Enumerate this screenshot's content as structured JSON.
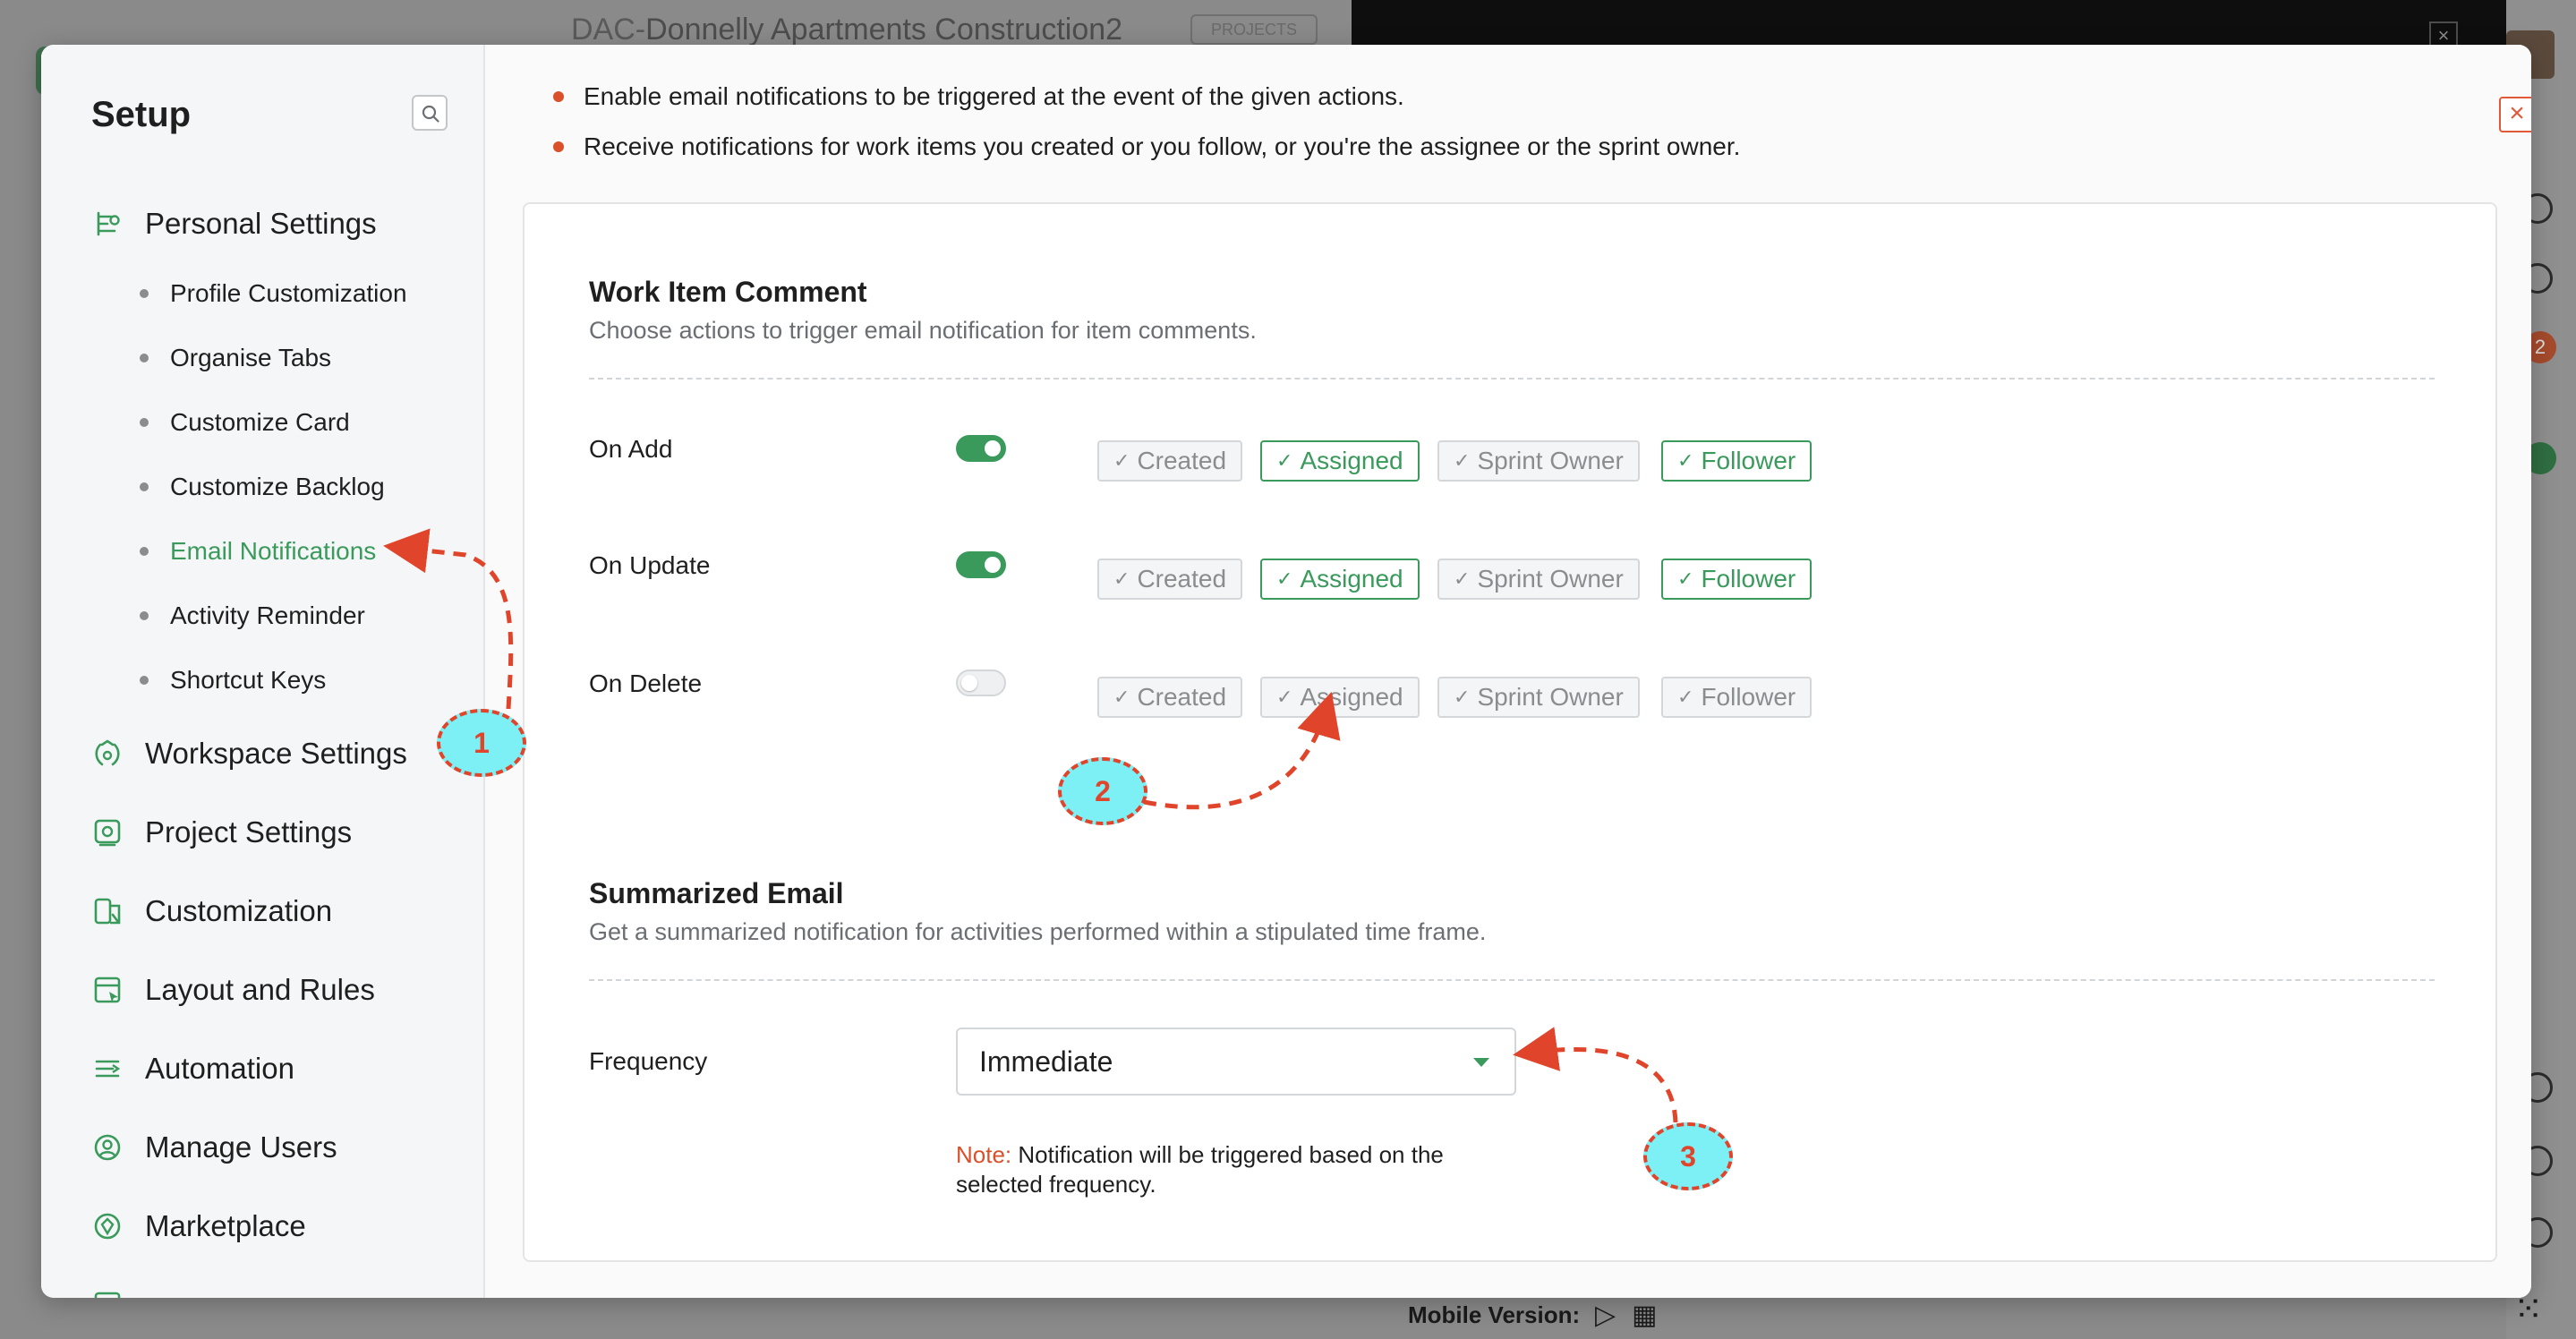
{
  "background": {
    "project_code": "DAC-",
    "project_name": "Donnelly Apartments Construction2",
    "project_badge": "PROJECTS",
    "rail_badge": "2",
    "mobile_label": "Mobile Version:"
  },
  "setup": {
    "title": "Setup",
    "search_icon": "search-icon",
    "groups": [
      {
        "label": "Personal Settings",
        "icon": "personal-settings-icon"
      },
      {
        "label": "Workspace Settings",
        "icon": "workspace-settings-icon"
      },
      {
        "label": "Project Settings",
        "icon": "project-settings-icon"
      },
      {
        "label": "Customization",
        "icon": "customization-icon"
      },
      {
        "label": "Layout and Rules",
        "icon": "layout-rules-icon"
      },
      {
        "label": "Automation",
        "icon": "automation-icon"
      },
      {
        "label": "Manage Users",
        "icon": "manage-users-icon"
      },
      {
        "label": "Marketplace",
        "icon": "marketplace-icon"
      }
    ],
    "personal_items": [
      {
        "label": "Profile Customization"
      },
      {
        "label": "Organise Tabs"
      },
      {
        "label": "Customize Card"
      },
      {
        "label": "Customize Backlog"
      },
      {
        "label": "Email Notifications",
        "active": true
      },
      {
        "label": "Activity Reminder"
      },
      {
        "label": "Shortcut Keys"
      }
    ]
  },
  "main": {
    "info": [
      "Enable email notifications to be triggered at the event of the given actions.",
      "Receive notifications for work items you created or you follow, or you're the assignee or the sprint owner."
    ],
    "comment_section": {
      "title": "Work Item Comment",
      "description": "Choose actions to trigger email notification for item comments.",
      "rows": [
        {
          "label": "On Add",
          "enabled": true,
          "options": [
            {
              "label": "Created",
              "selected": false
            },
            {
              "label": "Assigned",
              "selected": true
            },
            {
              "label": "Sprint Owner",
              "selected": false
            },
            {
              "label": "Follower",
              "selected": true
            }
          ]
        },
        {
          "label": "On Update",
          "enabled": true,
          "options": [
            {
              "label": "Created",
              "selected": false
            },
            {
              "label": "Assigned",
              "selected": true
            },
            {
              "label": "Sprint Owner",
              "selected": false
            },
            {
              "label": "Follower",
              "selected": true
            }
          ]
        },
        {
          "label": "On Delete",
          "enabled": false,
          "options": [
            {
              "label": "Created",
              "selected": false
            },
            {
              "label": "Assigned",
              "selected": false
            },
            {
              "label": "Sprint Owner",
              "selected": false
            },
            {
              "label": "Follower",
              "selected": false
            }
          ]
        }
      ]
    },
    "summary_section": {
      "title": "Summarized Email",
      "description": "Get a summarized notification for activities performed within a stipulated time frame.",
      "frequency_label": "Frequency",
      "frequency_value": "Immediate",
      "note_label": "Note:",
      "note_text": " Notification will be triggered based on the selected frequency."
    }
  },
  "annotations": {
    "callout_1": "1",
    "callout_2": "2",
    "callout_3": "3"
  },
  "colors": {
    "accent_green": "#3a9a5c",
    "annotation_red": "#e0442b",
    "callout_fill": "#7cf0f4",
    "bullet_orange": "#d9502b"
  }
}
